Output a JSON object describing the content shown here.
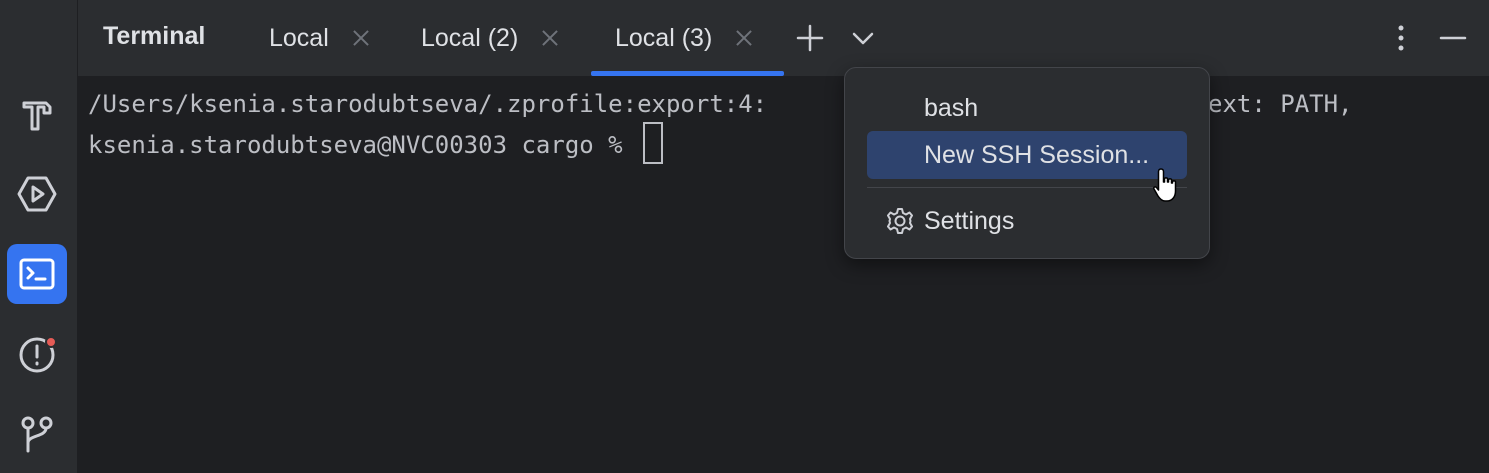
{
  "header": {
    "title": "Terminal",
    "tabs": [
      {
        "label": "Local"
      },
      {
        "label": "Local (2)"
      },
      {
        "label": "Local (3)",
        "active": true
      }
    ]
  },
  "terminal": {
    "line1": "/Users/ksenia.starodubtseva/.zprofile:export:4:",
    "line1_tail": "ext: PATH,",
    "prompt": "ksenia.starodubtseva@NVC00303 cargo % "
  },
  "popup": {
    "items": [
      {
        "label": "bash"
      },
      {
        "label": "New SSH Session...",
        "selected": true
      },
      {
        "label": "Settings",
        "icon": "gear-icon"
      }
    ]
  },
  "toolstrip": {
    "tools": [
      "hammer-icon",
      "run-icon",
      "terminal-icon",
      "problems-icon",
      "git-branch-icon"
    ]
  },
  "colors": {
    "accent": "#3574f0",
    "selection": "#2e436e",
    "notification": "#e55b56"
  }
}
